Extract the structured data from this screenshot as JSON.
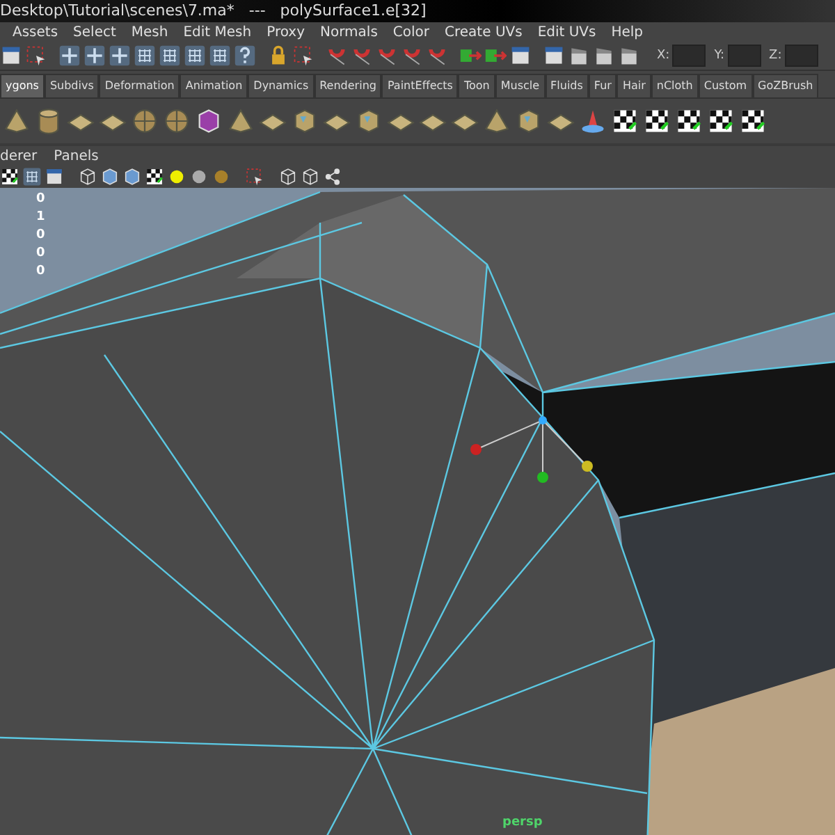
{
  "window": {
    "title": "Desktop\\Tutorial\\scenes\\7.ma*   ---   polySurface1.e[32]"
  },
  "menu_bar": [
    "Assets",
    "Select",
    "Mesh",
    "Edit Mesh",
    "Proxy",
    "Normals",
    "Color",
    "Create UVs",
    "Edit UVs",
    "Help"
  ],
  "status_line": {
    "fields": [
      {
        "label": "X:"
      },
      {
        "label": "Y:"
      },
      {
        "label": "Z:"
      }
    ]
  },
  "shelf_tabs": [
    {
      "label": "ygons",
      "selected": true
    },
    {
      "label": "Subdivs",
      "selected": false
    },
    {
      "label": "Deformation",
      "selected": false
    },
    {
      "label": "Animation",
      "selected": false
    },
    {
      "label": "Dynamics",
      "selected": false
    },
    {
      "label": "Rendering",
      "selected": false
    },
    {
      "label": "PaintEffects",
      "selected": false
    },
    {
      "label": "Toon",
      "selected": false
    },
    {
      "label": "Muscle",
      "selected": false
    },
    {
      "label": "Fluids",
      "selected": false
    },
    {
      "label": "Fur",
      "selected": false
    },
    {
      "label": "Hair",
      "selected": false
    },
    {
      "label": "nCloth",
      "selected": false
    },
    {
      "label": "Custom",
      "selected": false
    },
    {
      "label": "GoZBrush",
      "selected": false
    }
  ],
  "panel_menu": [
    "derer",
    "Panels"
  ],
  "viewport": {
    "stats": [
      "0",
      "1",
      "0",
      "0",
      "0"
    ],
    "camera_label": "persp"
  }
}
